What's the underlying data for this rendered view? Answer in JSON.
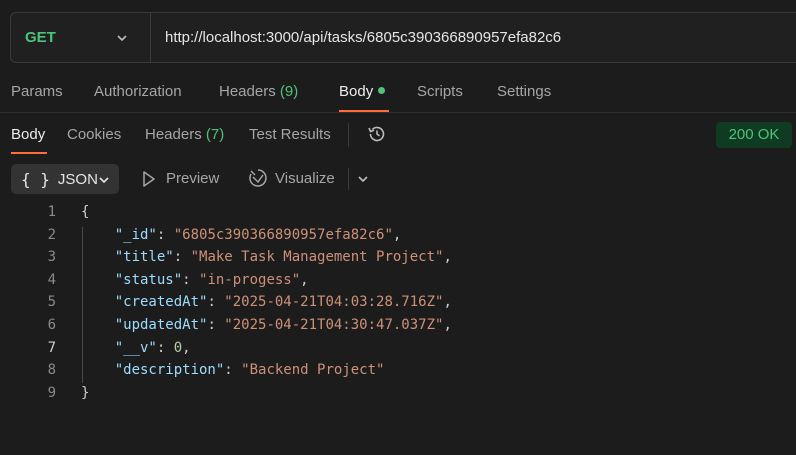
{
  "request": {
    "method": "GET",
    "url": "http://localhost:3000/api/tasks/6805c390366890957efa82c6"
  },
  "request_tabs": [
    {
      "label": "Params"
    },
    {
      "label": "Authorization"
    },
    {
      "label": "Headers",
      "count": "(9)"
    },
    {
      "label": "Body"
    },
    {
      "label": "Scripts"
    },
    {
      "label": "Settings"
    }
  ],
  "response_tabs": [
    {
      "label": "Body"
    },
    {
      "label": "Cookies"
    },
    {
      "label": "Headers",
      "count": "(7)"
    },
    {
      "label": "Test Results"
    }
  ],
  "response_status": "200 OK",
  "toolbar": {
    "format_braces": "{ }",
    "format": "JSON",
    "preview": "Preview",
    "visualize": "Visualize"
  },
  "code_lines": [
    {
      "n": "1",
      "indent": "",
      "key": "",
      "value": "",
      "open": "{",
      "tail": ""
    },
    {
      "n": "2",
      "indent": "    ",
      "key": "\"_id\"",
      "sep": ": ",
      "value": "\"6805c390366890957efa82c6\"",
      "vtype": "str",
      "tail": ","
    },
    {
      "n": "3",
      "indent": "    ",
      "key": "\"title\"",
      "sep": ": ",
      "value": "\"Make Task Management Project\"",
      "vtype": "str",
      "tail": ","
    },
    {
      "n": "4",
      "indent": "    ",
      "key": "\"status\"",
      "sep": ": ",
      "value": "\"in-progess\"",
      "vtype": "str",
      "tail": ","
    },
    {
      "n": "5",
      "indent": "    ",
      "key": "\"createdAt\"",
      "sep": ": ",
      "value": "\"2025-04-21T04:03:28.716Z\"",
      "vtype": "str",
      "tail": ","
    },
    {
      "n": "6",
      "indent": "    ",
      "key": "\"updatedAt\"",
      "sep": ": ",
      "value": "\"2025-04-21T04:30:47.037Z\"",
      "vtype": "str",
      "tail": ","
    },
    {
      "n": "7",
      "indent": "    ",
      "key": "\"__v\"",
      "sep": ": ",
      "value": "0",
      "vtype": "num",
      "tail": ","
    },
    {
      "n": "8",
      "indent": "    ",
      "key": "\"description\"",
      "sep": ": ",
      "value": "\"Backend Project\"",
      "vtype": "str",
      "tail": ""
    },
    {
      "n": "9",
      "indent": "",
      "key": "",
      "value": "",
      "open": "}",
      "tail": ""
    }
  ],
  "colors": {
    "accent": "#ff6c37",
    "get_method": "#4ec27a",
    "status_bg": "#0f3b22",
    "json_key": "#9cdcfe",
    "json_string": "#ce9178",
    "json_number": "#b5cea8"
  },
  "icons": [
    "chevron-down-icon",
    "history-icon",
    "play-icon",
    "visualize-icon"
  ]
}
